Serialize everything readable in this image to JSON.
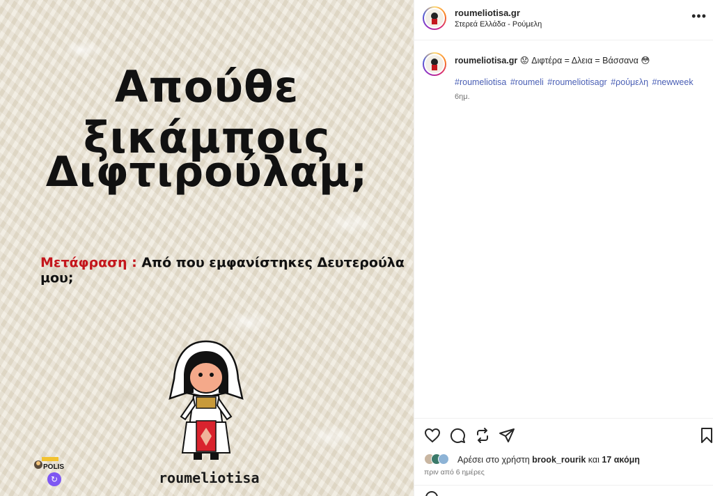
{
  "media": {
    "headline_line1": "Απούθε ξικάμποις",
    "headline_line2": "Διφτιρούλαμ;",
    "translation_label": "Μετάφραση :",
    "translation_text": "Από που εμφανίστηκες Δευτερούλα μου;",
    "brand": "roumeliotisa",
    "badge_text": "POLIS"
  },
  "header": {
    "username": "roumeliotisa.gr",
    "location": "Στερεά Ελλάδα - Ρούμελη",
    "more_icon": "more-horizontal-icon"
  },
  "caption": {
    "username": "roumeliotisa.gr",
    "text": "😟 Διφτέρα = Δλεια = Βάσσανα 😳",
    "hashtags": [
      "#roumeliotisa",
      "#roumeli",
      "#roumeliotisagr",
      "#ρούμελη",
      "#newweek"
    ],
    "time": "6ημ."
  },
  "actions": {
    "icons": [
      "heart-icon",
      "comment-icon",
      "repost-icon",
      "share-icon",
      "bookmark-icon"
    ],
    "likes_prefix": "Αρέσει στο χρήστη",
    "likes_user": "brook_rourik",
    "likes_and": "και",
    "likes_more": "17 ακόμη",
    "post_time": "πριν από 6 ημέρες"
  }
}
